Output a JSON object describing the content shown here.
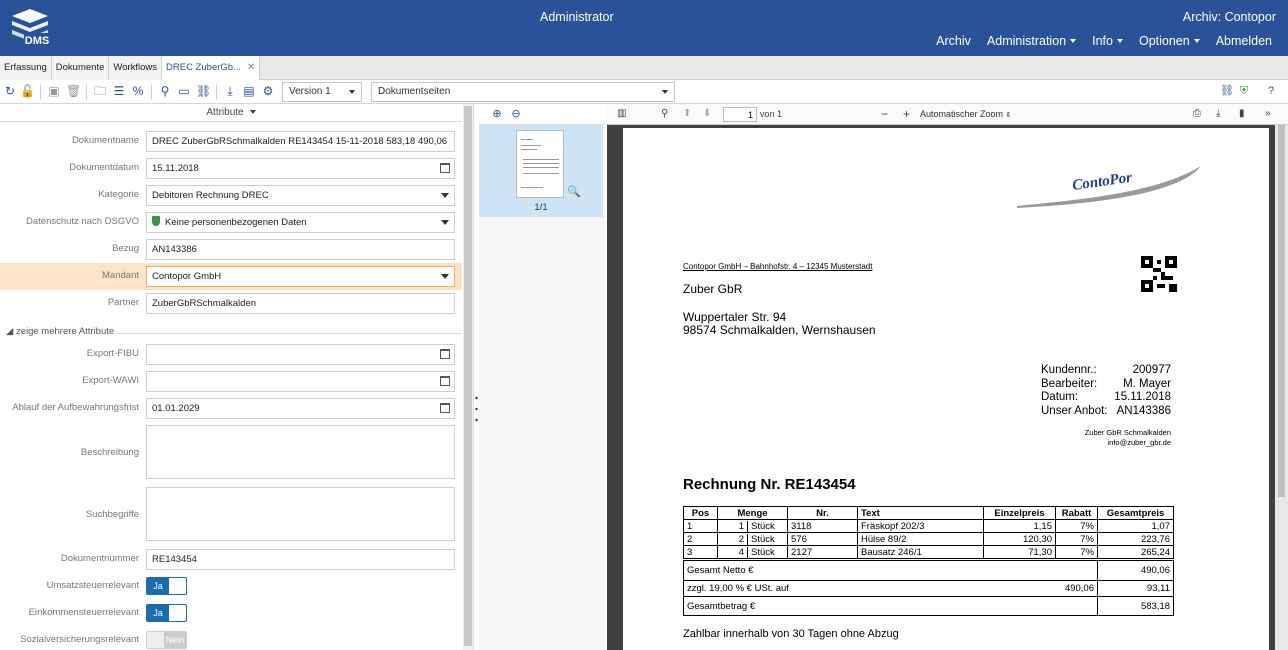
{
  "header": {
    "user": "Administrator",
    "archive": "Archiv: Contopor",
    "logo_text": "DMS",
    "nav": [
      {
        "label": "Archiv",
        "has_caret": false
      },
      {
        "label": "Administration",
        "has_caret": true
      },
      {
        "label": "Info",
        "has_caret": true
      },
      {
        "label": "Optionen",
        "has_caret": true
      },
      {
        "label": "Abmelden",
        "has_caret": false
      }
    ]
  },
  "tabs": [
    {
      "label": "Erfassung"
    },
    {
      "label": "Dokumente"
    },
    {
      "label": "Workflows"
    },
    {
      "label": "DREC ZuberGb..."
    }
  ],
  "toolbar": {
    "version": "Version 1",
    "pages": "Dokumentseiten"
  },
  "attributes": {
    "header": "Attribute",
    "fields": [
      {
        "label": "Dokumentname",
        "value": "DREC  ZuberGbRSchmalkalden  RE143454  15-11-2018  583,18  490,06"
      },
      {
        "label": "Dokumentdatum",
        "value": "15.11.2018"
      },
      {
        "label": "Kategorie",
        "value": "Debitoren Rechnung DREC"
      },
      {
        "label": "Datenschutz nach DSGVO",
        "value": "Keine personenbezogenen Daten"
      },
      {
        "label": "Bezug",
        "value": "AN143386"
      },
      {
        "label": "Mandant",
        "value": "Contopor GmbH"
      },
      {
        "label": "Partner",
        "value": "ZuberGbRSchmalkalden"
      }
    ],
    "more_label": "zeige mehrere Attribute",
    "extra_fields": [
      {
        "label": "Export-FIBU",
        "value": ""
      },
      {
        "label": "Export-WAWI",
        "value": ""
      },
      {
        "label": "Ablauf der Aufbewahrungsfrist",
        "value": "01.01.2029"
      },
      {
        "label": "Beschreibung",
        "value": ""
      },
      {
        "label": "Suchbegriffe",
        "value": ""
      },
      {
        "label": "Dokumentnummer",
        "value": "RE143454"
      }
    ],
    "toggles": [
      {
        "label": "Umsatzsteuerrelevant",
        "value": "Ja",
        "on": true
      },
      {
        "label": "Einkommensteuerrelevant",
        "value": "Ja",
        "on": true
      },
      {
        "label": "Sozialversicherungsrelevant",
        "value": "Nein",
        "on": false
      }
    ]
  },
  "thumbnails": {
    "page_label": "1/1"
  },
  "viewer": {
    "page_number": "1",
    "page_count": "von 1",
    "zoom": "Automatischer Zoom"
  },
  "document": {
    "logo_text": "ContoPor",
    "sender_line": "Contopor GmbH – Bahnhofstr. 4 – 12345 Musterstadt",
    "recipient_name": "Zuber GbR",
    "recipient_street": "Wuppertaler Str. 94",
    "recipient_city": "98574 Schmalkalden, Wernshausen",
    "info": [
      {
        "label": "Kundennr.:",
        "value": "200977"
      },
      {
        "label": "Bearbeiter:",
        "value": "M. Mayer"
      },
      {
        "label": "Datum:",
        "value": "15.11.2018"
      },
      {
        "label": "Unser Anbot:",
        "value": "AN143386"
      }
    ],
    "contact_name": "Zuber GbR Schmalkalden",
    "contact_email": "info@zuber_gbr.de",
    "title": "Rechnung Nr. RE143454",
    "table_headers": [
      "Pos",
      "Menge",
      "Nr.",
      "Text",
      "Einzelpreis",
      "Rabatt",
      "Gesamtpreis"
    ],
    "rows": [
      {
        "pos": "1",
        "qty": "1",
        "unit": "Stück",
        "nr": "3118",
        "text": "Fräskopf 202/3",
        "price": "1,15",
        "discount": "7%",
        "total": "1,07"
      },
      {
        "pos": "2",
        "qty": "2",
        "unit": "Stück",
        "nr": "576",
        "text": "Hülse 89/2",
        "price": "120,30",
        "discount": "7%",
        "total": "223,76"
      },
      {
        "pos": "3",
        "qty": "4",
        "unit": "Stück",
        "nr": "2127",
        "text": "Bausatz 246/1",
        "price": "71,30",
        "discount": "7%",
        "total": "265,24"
      }
    ],
    "net_label": "Gesamt Netto €",
    "net_value": "490,06",
    "tax_label": "zzgl. 19,00 % € USt. auf",
    "tax_base": "490,06",
    "tax_value": "93,11",
    "gross_label": "Gesamtbetrag €",
    "gross_value": "583,18",
    "payment": "Zahlbar innerhalb von 30 Tagen ohne Abzug"
  }
}
